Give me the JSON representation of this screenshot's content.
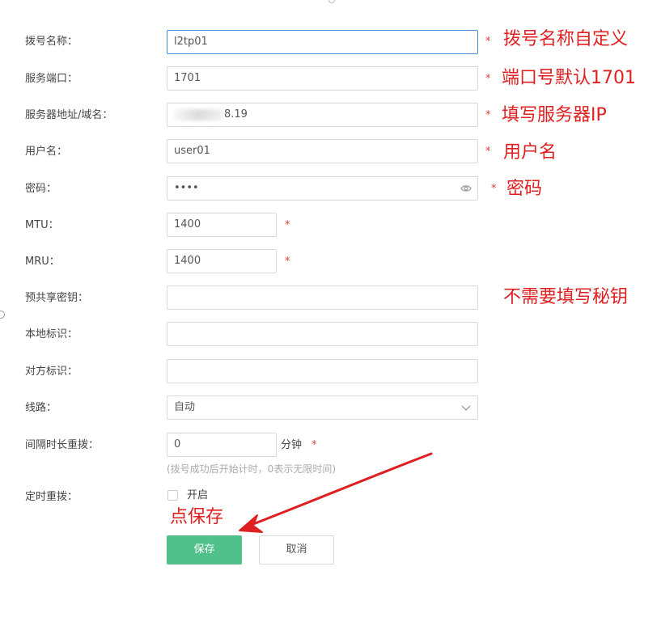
{
  "form": {
    "dial_name": {
      "label": "拨号名称：",
      "value": "l2tp01"
    },
    "port": {
      "label": "服务端口：",
      "value": "1701"
    },
    "server": {
      "label": "服务器地址/域名：",
      "value_suffix": "8.19"
    },
    "username": {
      "label": "用户名：",
      "value": "user01"
    },
    "password": {
      "label": "密码：",
      "value": "••••"
    },
    "mtu": {
      "label": "MTU：",
      "value": "1400"
    },
    "mru": {
      "label": "MRU：",
      "value": "1400"
    },
    "psk": {
      "label": "预共享密钥：",
      "value": ""
    },
    "local_id": {
      "label": "本地标识：",
      "value": ""
    },
    "remote_id": {
      "label": "对方标识：",
      "value": ""
    },
    "line": {
      "label": "线路：",
      "selected": "自动"
    },
    "redial_interval": {
      "label": "间隔时长重拨：",
      "value": "0",
      "unit": "分钟",
      "hint": "(拨号成功后开始计时，0表示无限时间)"
    },
    "timed_redial": {
      "label": "定时重拨：",
      "checkbox_label": "开启"
    },
    "required_mark": "*"
  },
  "buttons": {
    "save": "保存",
    "cancel": "取消"
  },
  "annotations": {
    "dial_name": "拨号名称自定义",
    "port": "端口号默认1701",
    "server": "填写服务器IP",
    "username": "用户名",
    "password": "密码",
    "psk": "不需要填写秘钥",
    "save": "点保存"
  },
  "colors": {
    "annotation": "#e02020",
    "save_button": "#52c08a",
    "required": "#e0433a",
    "focus_border": "#4a90d9"
  }
}
